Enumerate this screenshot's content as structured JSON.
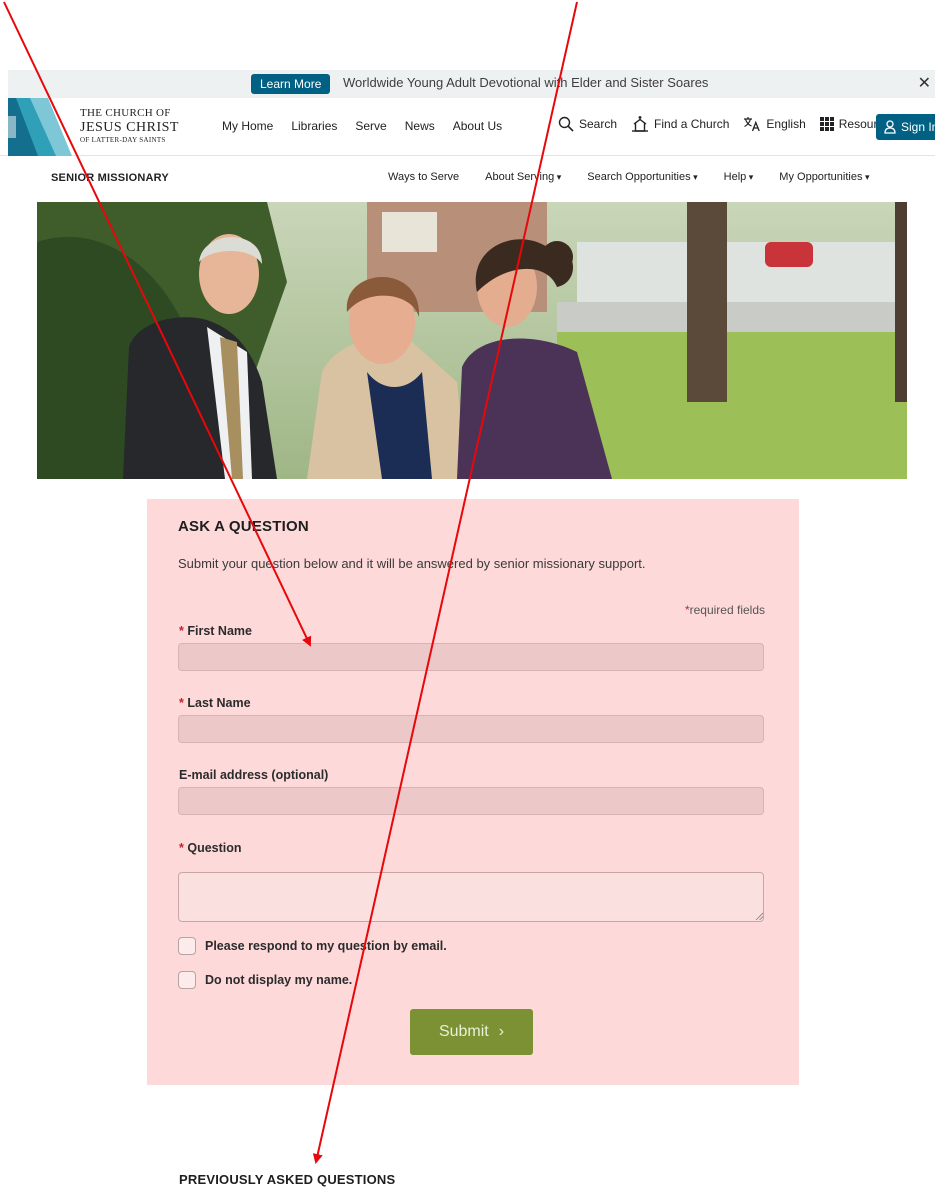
{
  "announcement": {
    "button_label": "Learn More",
    "text": "Worldwide Young Adult Devotional with Elder and Sister Soares",
    "close_glyph": "✕"
  },
  "logo": {
    "line1": "THE CHURCH OF",
    "line2": "JESUS CHRIST",
    "line3": "OF LATTER-DAY SAINTS"
  },
  "main_nav": [
    "My Home",
    "Libraries",
    "Serve",
    "News",
    "About Us"
  ],
  "tools": {
    "search": "Search",
    "find_church": "Find a Church",
    "language": "English",
    "resources": "Resources",
    "sign_in": "Sign In"
  },
  "subnav": {
    "title": "SENIOR MISSIONARY",
    "links": [
      "Ways to Serve",
      "About Serving",
      "Search Opportunities",
      "Help",
      "My Opportunities"
    ]
  },
  "form": {
    "title": "ASK A QUESTION",
    "description": "Submit your question below and it will be answered by senior missionary support.",
    "required_star": "*",
    "required_note": "required fields",
    "first_name_label": "First Name",
    "last_name_label": "Last Name",
    "email_label": "E-mail address (optional)",
    "question_label": "Question",
    "first_name_value": "",
    "last_name_value": "",
    "email_value": "",
    "question_value": "",
    "respond_by_email_label": "Please respond to my question by email.",
    "hide_name_label": "Do not display my name.",
    "submit_label": "Submit",
    "submit_chevron": "›"
  },
  "previous": {
    "title": "PREVIOUSLY ASKED QUESTIONS"
  },
  "colors": {
    "brand_blue": "#006184",
    "form_bg": "#fdd9d9",
    "submit_green": "#7b9134",
    "required_red": "#c02230",
    "annotation_red": "#e8070a"
  }
}
